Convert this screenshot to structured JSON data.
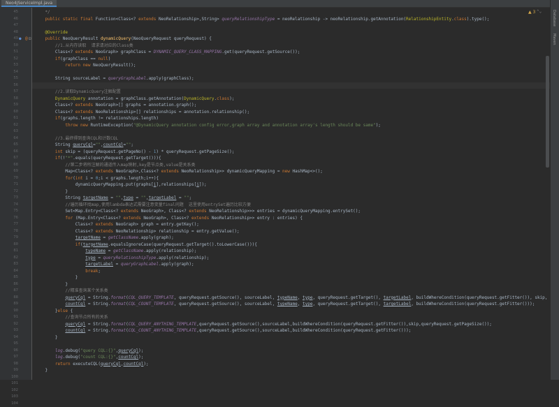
{
  "editor_tab": {
    "label": "Neo4jServiceImpl.java"
  },
  "right_sidebar": {
    "items": [
      "Database",
      "Maven"
    ]
  },
  "inspection": {
    "warning_count": "3"
  },
  "line_numbers": [
    "45",
    "46",
    "47",
    "48",
    "49",
    "50",
    "51",
    "52",
    "53",
    "54",
    "55",
    "56",
    "57",
    "58",
    "59",
    "60",
    "61",
    "62",
    "63",
    "64",
    "65",
    "66",
    "67",
    "68",
    "69",
    "70",
    "71",
    "72",
    "73",
    "74",
    "75",
    "76",
    "77",
    "78",
    "79",
    "80",
    "81",
    "82",
    "83",
    "84",
    "85",
    "86",
    "87",
    "88",
    "89",
    "90",
    "91",
    "92",
    "93",
    "94",
    "95",
    "96",
    "97",
    "98",
    "99",
    "100",
    "101",
    "102",
    "103",
    "104"
  ],
  "code_lines": [
    [
      {
        "t": "    */",
        "c": "cm"
      }
    ],
    [
      {
        "t": "    public static final ",
        "c": "kw"
      },
      {
        "t": "Function<Class<? "
      },
      {
        "t": "extends ",
        "c": "kw"
      },
      {
        "t": "NeoRelationship>,String> "
      },
      {
        "t": "queryRelationshipType",
        "c": "fld"
      },
      {
        "t": " = neoRelationship -> neoRelationship.getAnnotation("
      },
      {
        "t": "RelationshipEntity",
        "c": "an"
      },
      {
        "t": "."
      },
      {
        "t": "class",
        "c": "kw"
      },
      {
        "t": ").type();"
      }
    ],
    [],
    [
      {
        "t": "    @Override",
        "c": "an"
      }
    ],
    [
      {
        "t": "    public ",
        "c": "kw"
      },
      {
        "t": "NeoQueryResult "
      },
      {
        "t": "dynamicQuery",
        "c": "mth"
      },
      {
        "t": "(NeoQueryRequest queryRequest) {"
      }
    ],
    [
      {
        "t": "        //1.从内存读取  请求请对应的Class类",
        "c": "cm"
      }
    ],
    [
      {
        "t": "        Class<? "
      },
      {
        "t": "extends ",
        "c": "kw"
      },
      {
        "t": "NeoGraph> graphClass = "
      },
      {
        "t": "DYNAMIC_QUERY_CLASS_MAPPING",
        "c": "fld"
      },
      {
        "t": ".get(queryRequest.getSource());"
      }
    ],
    [
      {
        "t": "        "
      },
      {
        "t": "if",
        "c": "kw"
      },
      {
        "t": "(graphClass == "
      },
      {
        "t": "null",
        "c": "kw"
      },
      {
        "t": ")"
      }
    ],
    [
      {
        "t": "            "
      },
      {
        "t": "return new ",
        "c": "kw"
      },
      {
        "t": "NeoQueryResult();"
      }
    ],
    [],
    [
      {
        "t": "        String sourceLabel = "
      },
      {
        "t": "queryGraphLabel",
        "c": "fld"
      },
      {
        "t": ".apply(graphClass);"
      }
    ],
    [],
    [
      {
        "t": "        //2.读取DynamicQuery注解配置",
        "c": "cm"
      }
    ],
    [
      {
        "t": "        DynamicQuery",
        "c": "an"
      },
      {
        "t": " annotation = graphClass.getAnnotation("
      },
      {
        "t": "DynamicQuery",
        "c": "an"
      },
      {
        "t": "."
      },
      {
        "t": "class",
        "c": "kw"
      },
      {
        "t": ");"
      }
    ],
    [
      {
        "t": "        Class<? "
      },
      {
        "t": "extends ",
        "c": "kw"
      },
      {
        "t": "NeoGraph>[] graphs = annotation.graph();"
      }
    ],
    [
      {
        "t": "        Class<? "
      },
      {
        "t": "extends ",
        "c": "kw"
      },
      {
        "t": "NeoRelationship>[] relationships = annotation.relationship();"
      }
    ],
    [
      {
        "t": "        "
      },
      {
        "t": "if",
        "c": "kw"
      },
      {
        "t": "(graphs.length != relationships.length)"
      }
    ],
    [
      {
        "t": "            "
      },
      {
        "t": "throw new ",
        "c": "kw"
      },
      {
        "t": "RuntimeException("
      },
      {
        "t": "\"@DynamicQuery annotation config error,graph array and annotation array's length should be same\"",
        "c": "str"
      },
      {
        "t": ");"
      }
    ],
    [],
    [
      {
        "t": "        //3.最终得到查询CQL和计数CQL",
        "c": "cm"
      }
    ],
    [
      {
        "t": "        String "
      },
      {
        "t": "queryCql",
        "c": "ul"
      },
      {
        "t": "="
      },
      {
        "t": "\"\"",
        "c": "str"
      },
      {
        "t": ","
      },
      {
        "t": "countCql",
        "c": "ul"
      },
      {
        "t": "="
      },
      {
        "t": "\"\"",
        "c": "str"
      },
      {
        "t": ";"
      }
    ],
    [
      {
        "t": "        "
      },
      {
        "t": "int ",
        "c": "kw"
      },
      {
        "t": "skip = (queryRequest.getPageNo() - "
      },
      {
        "t": "1",
        "c": "num"
      },
      {
        "t": ") * queryRequest.getPageSize();"
      }
    ],
    [
      {
        "t": "        "
      },
      {
        "t": "if",
        "c": "kw"
      },
      {
        "t": "(!"
      },
      {
        "t": "\"*\"",
        "c": "str"
      },
      {
        "t": ".equals(queryRequest.getTarget())){"
      }
    ],
    [
      {
        "t": "            //第二步将所注解的通道传入map映射,key是节点类,value是关系类",
        "c": "cm"
      }
    ],
    [
      {
        "t": "            Map<Class<? "
      },
      {
        "t": "extends ",
        "c": "kw"
      },
      {
        "t": "NeoGraph>,Class<? "
      },
      {
        "t": "extends ",
        "c": "kw"
      },
      {
        "t": "NeoRelationship>> dynamicQueryMapping = "
      },
      {
        "t": "new ",
        "c": "kw"
      },
      {
        "t": "HashMap<>();"
      }
    ],
    [
      {
        "t": "            "
      },
      {
        "t": "for",
        "c": "kw"
      },
      {
        "t": "("
      },
      {
        "t": "int ",
        "c": "kw"
      },
      {
        "t": "i = "
      },
      {
        "t": "0",
        "c": "num"
      },
      {
        "t": ";i < graphs.length;i++){"
      }
    ],
    [
      {
        "t": "                dynamicQueryMapping.put(graphs["
      },
      {
        "t": "i",
        "c": "ul"
      },
      {
        "t": "],relationships["
      },
      {
        "t": "i",
        "c": "ul"
      },
      {
        "t": "]);"
      }
    ],
    [
      {
        "t": "            }"
      }
    ],
    [
      {
        "t": "            String "
      },
      {
        "t": "targetName",
        "c": "ul"
      },
      {
        "t": " = "
      },
      {
        "t": "\"\"",
        "c": "str"
      },
      {
        "t": ","
      },
      {
        "t": "type",
        "c": "ul"
      },
      {
        "t": " = "
      },
      {
        "t": "\"\"",
        "c": "str"
      },
      {
        "t": ","
      },
      {
        "t": "targetLabel",
        "c": "ul"
      },
      {
        "t": " = "
      },
      {
        "t": "\"\"",
        "c": "str"
      },
      {
        "t": ";"
      }
    ],
    [
      {
        "t": "            //遍历循环找map,使用lambda表达式需要注意变量final问题  这里使用entrySet遍历比较方便",
        "c": "cm"
      }
    ],
    [
      {
        "t": "            Set<Map.Entry<Class<? "
      },
      {
        "t": "extends ",
        "c": "kw"
      },
      {
        "t": "NeoGraph>, Class<? "
      },
      {
        "t": "extends ",
        "c": "kw"
      },
      {
        "t": "NeoRelationship>>> entries = dynamicQueryMapping.entrySet();"
      }
    ],
    [
      {
        "t": "            "
      },
      {
        "t": "for ",
        "c": "kw"
      },
      {
        "t": "(Map.Entry<Class<? "
      },
      {
        "t": "extends ",
        "c": "kw"
      },
      {
        "t": "NeoGraph>, Class<? "
      },
      {
        "t": "extends ",
        "c": "kw"
      },
      {
        "t": "NeoRelationship>> entry : entries) {"
      }
    ],
    [
      {
        "t": "                Class<? "
      },
      {
        "t": "extends ",
        "c": "kw"
      },
      {
        "t": "NeoGraph> graph = entry.getKey();"
      }
    ],
    [
      {
        "t": "                Class<? "
      },
      {
        "t": "extends ",
        "c": "kw"
      },
      {
        "t": "NeoRelationship> relationship = entry.getValue();"
      }
    ],
    [
      {
        "t": "                "
      },
      {
        "t": "targetName",
        "c": "ul"
      },
      {
        "t": " = "
      },
      {
        "t": "getClassName",
        "c": "fld"
      },
      {
        "t": ".apply(graph);"
      }
    ],
    [
      {
        "t": "                "
      },
      {
        "t": "if",
        "c": "kw"
      },
      {
        "t": "("
      },
      {
        "t": "targetName",
        "c": "ul"
      },
      {
        "t": ".equalsIgnoreCase(queryRequest.getTarget().toLowerCase())){"
      }
    ],
    [
      {
        "t": "                    "
      },
      {
        "t": "typeName",
        "c": "ul"
      },
      {
        "t": " = "
      },
      {
        "t": "getClassName",
        "c": "fld"
      },
      {
        "t": ".apply(relationship);"
      }
    ],
    [
      {
        "t": "                    "
      },
      {
        "t": "type",
        "c": "ul"
      },
      {
        "t": " = "
      },
      {
        "t": "queryRelationshipType",
        "c": "fld"
      },
      {
        "t": ".apply(relationship);"
      }
    ],
    [
      {
        "t": "                    "
      },
      {
        "t": "targetLabel",
        "c": "ul"
      },
      {
        "t": " = "
      },
      {
        "t": "queryGraphLabel",
        "c": "fld"
      },
      {
        "t": ".apply(graph);"
      }
    ],
    [
      {
        "t": "                    "
      },
      {
        "t": "break",
        "c": "kw"
      },
      {
        "t": ";"
      }
    ],
    [
      {
        "t": "                }"
      }
    ],
    [
      {
        "t": "            }"
      }
    ],
    [
      {
        "t": "            //精准查询某个关系类",
        "c": "cm"
      }
    ],
    [
      {
        "t": "            "
      },
      {
        "t": "queryCql",
        "c": "ul"
      },
      {
        "t": " = String."
      },
      {
        "t": "format",
        "c": "fld"
      },
      {
        "t": "("
      },
      {
        "t": "CQL_QUERY_TEMPLATE",
        "c": "fld"
      },
      {
        "t": ", queryRequest.getSource(), sourceLabel, "
      },
      {
        "t": "typeName",
        "c": "ul"
      },
      {
        "t": ", "
      },
      {
        "t": "type",
        "c": "ul"
      },
      {
        "t": ", queryRequest.getTarget(), "
      },
      {
        "t": "targetLabel",
        "c": "ul"
      },
      {
        "t": ", buildWhereCondition(queryRequest.getFitter()), skip, queryRequest.getPageSize());"
      }
    ],
    [
      {
        "t": "            "
      },
      {
        "t": "countCql",
        "c": "ul"
      },
      {
        "t": " = String."
      },
      {
        "t": "format",
        "c": "fld"
      },
      {
        "t": "("
      },
      {
        "t": "CQL_COUNT_TEMPLATE",
        "c": "fld"
      },
      {
        "t": ", queryRequest.getSource(), sourceLabel, "
      },
      {
        "t": "typeName",
        "c": "ul"
      },
      {
        "t": ", "
      },
      {
        "t": "type",
        "c": "ul"
      },
      {
        "t": ", queryRequest.getTarget(), "
      },
      {
        "t": "targetLabel",
        "c": "ul"
      },
      {
        "t": ", buildWhereCondition(queryRequest.getFitter()));"
      }
    ],
    [
      {
        "t": "        }"
      },
      {
        "t": "else ",
        "c": "kw"
      },
      {
        "t": "{"
      }
    ],
    [
      {
        "t": "            //查询节点所有的关系",
        "c": "cm"
      }
    ],
    [
      {
        "t": "            "
      },
      {
        "t": "queryCql",
        "c": "ul"
      },
      {
        "t": " = String."
      },
      {
        "t": "format",
        "c": "fld"
      },
      {
        "t": "("
      },
      {
        "t": "CQL_QUERY_ANYTHING_TEMPLATE",
        "c": "fld"
      },
      {
        "t": ",queryRequest.getSource(),sourceLabel,buildWhereCondition(queryRequest.getFitter()),skip,queryRequest.getPageSize());"
      }
    ],
    [
      {
        "t": "            "
      },
      {
        "t": "countCql",
        "c": "ul"
      },
      {
        "t": " = String."
      },
      {
        "t": "format",
        "c": "fld"
      },
      {
        "t": "("
      },
      {
        "t": "CQL_COUNT_ANYTHING_TEMPLATE",
        "c": "fld"
      },
      {
        "t": ",queryRequest.getSource(),sourceLabel,buildWhereCondition(queryRequest.getFitter()));"
      }
    ],
    [
      {
        "t": "        }"
      }
    ],
    [],
    [
      {
        "t": "        "
      },
      {
        "t": "log",
        "c": "fld"
      },
      {
        "t": ".debug("
      },
      {
        "t": "\"query CQL:{}\"",
        "c": "str"
      },
      {
        "t": ","
      },
      {
        "t": "queryCql",
        "c": "ul"
      },
      {
        "t": ");"
      }
    ],
    [
      {
        "t": "        "
      },
      {
        "t": "log",
        "c": "fld"
      },
      {
        "t": ".debug("
      },
      {
        "t": "\"count CQL:{}\"",
        "c": "str"
      },
      {
        "t": ","
      },
      {
        "t": "countCql",
        "c": "ul"
      },
      {
        "t": ");"
      }
    ],
    [
      {
        "t": "        "
      },
      {
        "t": "return ",
        "c": "kw"
      },
      {
        "t": "executeCQL("
      },
      {
        "t": "queryCql",
        "c": "ul"
      },
      {
        "t": ","
      },
      {
        "t": "countCql",
        "c": "ul"
      },
      {
        "t": ");"
      }
    ],
    [
      {
        "t": "    }"
      }
    ]
  ]
}
